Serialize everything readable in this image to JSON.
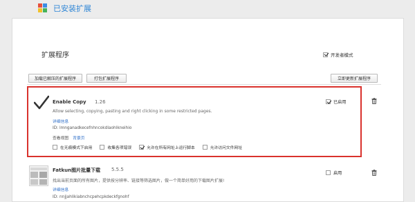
{
  "header": {
    "title": "已安装扩展"
  },
  "section": {
    "title": "扩展程序",
    "developer_mode_label": "开发者模式",
    "developer_mode_checked": true
  },
  "toolbar": {
    "load_unpacked": "加载已解压的扩展程序",
    "pack": "打包扩展程序",
    "update_now": "立即更新扩展程序"
  },
  "extensions": [
    {
      "name": "Enable Copy",
      "version": "1.26",
      "description": "Allow selecting, copying, pasting and right clicking in some restricted pages.",
      "details_link": "详细信息",
      "id_text": "ID: lmnganadkecefnhncokdlaohlkneihio",
      "views_label": "查看视图",
      "background_page_link": "背景页",
      "options": [
        {
          "label": "在无痕模式下启用",
          "checked": false
        },
        {
          "label": "收集各项错误",
          "checked": false
        },
        {
          "label": "允许在所有网址上运行脚本",
          "checked": true
        },
        {
          "label": "允许访问文件网址",
          "checked": false
        }
      ],
      "enabled_label": "已启用",
      "enabled": true
    },
    {
      "name": "Fatkun图片批量下载",
      "version": "5.5.5",
      "description": "找出当前页面的所有图片，提供按分辨率、链接等筛选图片，做一个简单好用的下载图片扩展!",
      "details_link": "详细信息",
      "id_text": "ID: nnjjahlikiabnchcpehcpkdeckfgnohf",
      "enabled_label": "启用",
      "enabled": false
    }
  ],
  "icons": {
    "enabled_check": "checkmark-icon",
    "delete": "trash-icon",
    "app_logo": "extensions-logo-icon"
  }
}
